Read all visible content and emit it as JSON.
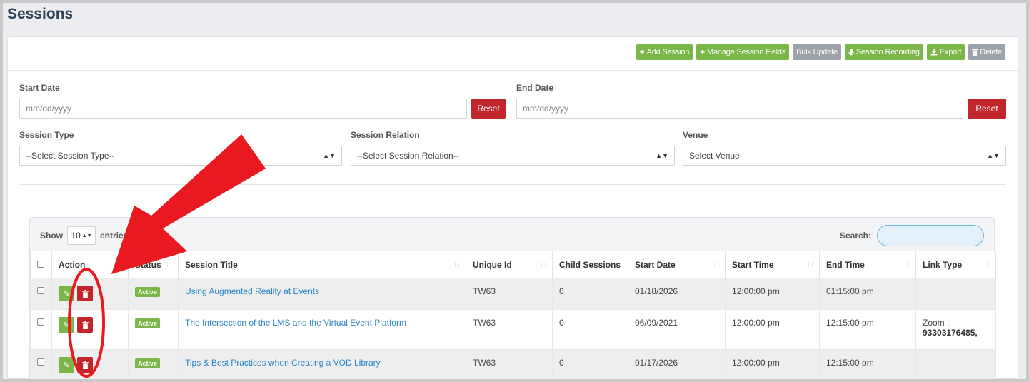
{
  "page": {
    "title": "Sessions"
  },
  "toolbar": {
    "add_session": "Add Session",
    "manage_fields": "Manage Session Fields",
    "bulk_update": "Bulk Update",
    "session_recording": "Session Recording",
    "export": "Export",
    "delete": "Delete"
  },
  "filters": {
    "start_date": {
      "label": "Start Date",
      "placeholder": "mm/dd/yyyy",
      "reset": "Reset"
    },
    "end_date": {
      "label": "End Date",
      "placeholder": "mm/dd/yyyy",
      "reset": "Reset"
    },
    "session_type": {
      "label": "Session Type",
      "value": "--Select Session Type--"
    },
    "session_relation": {
      "label": "Session Relation",
      "value": "--Select Session Relation--"
    },
    "venue": {
      "label": "Venue",
      "value": "Select Venue"
    }
  },
  "table": {
    "show_label": "Show",
    "page_size": "10",
    "entries_label": "entries",
    "search_label": "Search:",
    "columns": {
      "action": "Action",
      "status": "Status",
      "title": "Session Title",
      "unique_id": "Unique Id",
      "child_sessions": "Child Sessions",
      "start_date": "Start Date",
      "start_time": "Start Time",
      "end_time": "End Time",
      "link_type": "Link Type"
    },
    "rows": [
      {
        "status": "Active",
        "title": "Using Augmented Reality at Events",
        "unique_id": "TW63",
        "child_sessions": "0",
        "start_date": "01/18/2026",
        "start_time": "12:00:00 pm",
        "end_time": "01:15:00 pm",
        "link_type": "",
        "link_number": ""
      },
      {
        "status": "Active",
        "title": "The Intersection of the LMS and the Virtual Event Platform",
        "unique_id": "TW63",
        "child_sessions": "0",
        "start_date": "06/09/2021",
        "start_time": "12:00:00 pm",
        "end_time": "12:15:00 pm",
        "link_type": "Zoom :",
        "link_number": "93303176485,"
      },
      {
        "status": "Active",
        "title": "Tips & Best Practices when Creating a VOD Library",
        "unique_id": "TW63",
        "child_sessions": "0",
        "start_date": "01/17/2026",
        "start_time": "12:00:00 pm",
        "end_time": "12:15:00 pm",
        "link_type": "",
        "link_number": ""
      }
    ]
  },
  "colors": {
    "green": "#7ab648",
    "red": "#c0262b",
    "annotation": "#e8191f"
  },
  "icons": {
    "edit": "edit-icon",
    "delete": "trash-icon",
    "add": "plus-icon",
    "mic": "microphone-icon",
    "export": "download-icon"
  }
}
